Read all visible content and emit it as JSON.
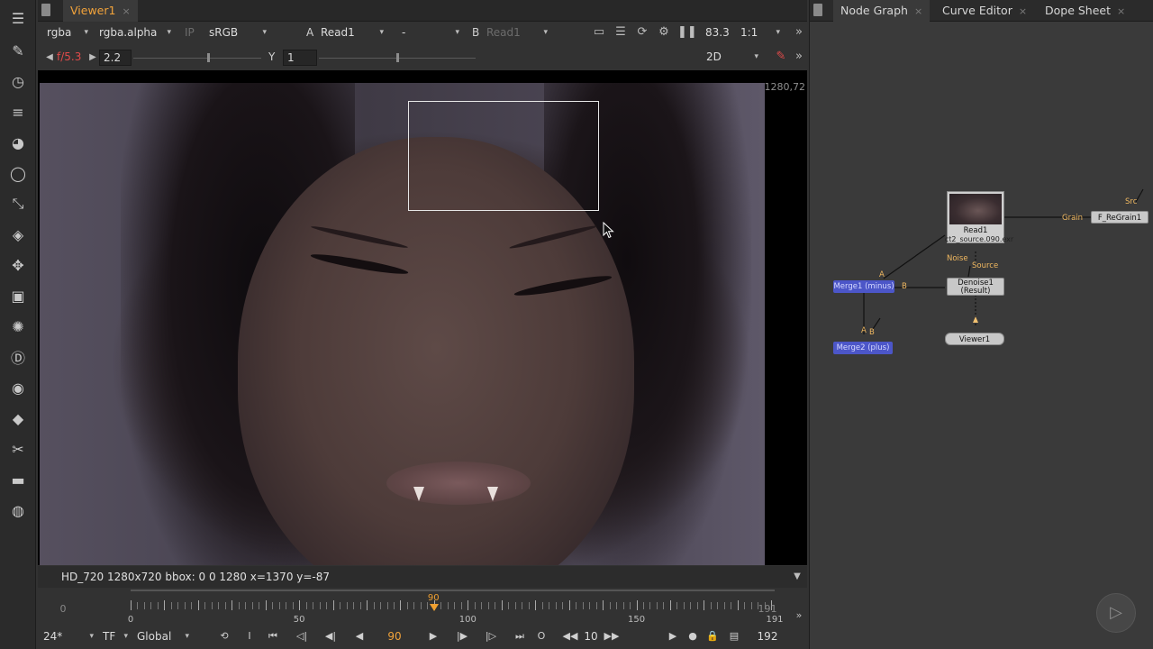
{
  "toolbar": {
    "icons": [
      "toolbar-menu-icon",
      "brush-icon",
      "clock-icon",
      "channel-icon",
      "color-wheel-icon",
      "filter-sphere-icon",
      "keyer-icon",
      "layers-icon",
      "transform-icon",
      "3d-cube-icon",
      "particles-icon",
      "d-icon",
      "eye-icon",
      "toolsets-icon",
      "wrench-icon",
      "metadata-icon",
      "furnace-icon"
    ]
  },
  "viewer": {
    "tab": {
      "label": "Viewer1",
      "close": "×"
    },
    "controls": {
      "channels": "rgba",
      "alpha": "rgba.alpha",
      "ip": "IP",
      "colorspace": "sRGB",
      "a_label": "A",
      "a_input": "Read1",
      "compare": "-",
      "b_label": "B",
      "b_input": "Read1",
      "zoom": "83.3",
      "proxy": "1:1",
      "fstop": "f/5.3",
      "gain": "2.2",
      "gamma_label": "Y",
      "gamma": "1",
      "view_mode": "2D",
      "gain_ticks": [
        "1/16",
        "1/8",
        "1/4",
        "1/2",
        "1",
        "2",
        "4",
        "8",
        "16"
      ],
      "gamma_ticks": [
        "0",
        "0.5",
        "1",
        "1.5",
        "2",
        "2.5"
      ]
    },
    "resolution_label": "1280,72",
    "info": "HD_720 1280x720  bbox: 0 0 1280  x=1370 y=-87"
  },
  "timeline": {
    "in_frame": "0",
    "out_frame": "191",
    "labels": [
      "0",
      "50",
      "100",
      "150",
      "191"
    ],
    "current": "90",
    "playhead_label": "90"
  },
  "transport": {
    "fps": "24*",
    "timecode_mode": "TF",
    "scope": "Global",
    "in_btn": "I",
    "out_btn": "O",
    "current_frame": "90",
    "increment": "10",
    "end_frame": "192"
  },
  "graph": {
    "tabs": [
      {
        "label": "Node Graph",
        "close": "×"
      },
      {
        "label": "Curve Editor",
        "close": "×"
      },
      {
        "label": "Dope Sheet",
        "close": "×"
      }
    ],
    "nodes": {
      "read": {
        "name": "Read1",
        "file": "ct2_source.090.exr"
      },
      "regrain": "F_ReGrain1",
      "merge1": "Merge1 (minus)",
      "denoise": "Denoise1",
      "denoise_sub": "(Result)",
      "merge2": "Merge2 (plus)",
      "viewer": "Viewer1"
    },
    "edge_labels": {
      "src": "Src",
      "grain": "Grain",
      "noise": "Noise",
      "source": "Source",
      "a1": "A",
      "b1": "B",
      "a2": "A",
      "b2": "B"
    }
  }
}
